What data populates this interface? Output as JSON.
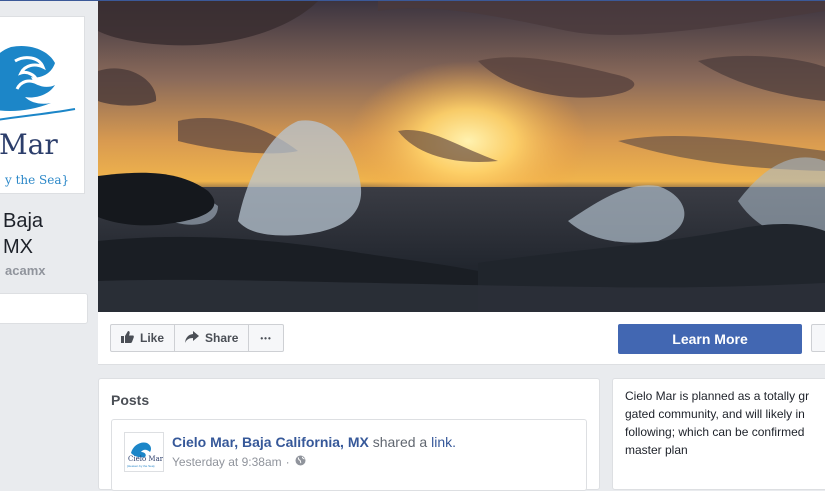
{
  "page": {
    "name_line1": "Baja",
    "name_line2": "MX",
    "handle": "acamx",
    "logo_text": "Mar",
    "logo_tagline": "y the Sea}"
  },
  "actions": {
    "like_label": "Like",
    "share_label": "Share",
    "more_label": "•••",
    "learn_more_label": "Learn More"
  },
  "posts": {
    "title": "Posts",
    "post": {
      "author": "Cielo Mar, Baja California, MX",
      "action_prefix": "shared a",
      "action_link": "link.",
      "timestamp": "Yesterday at 9:38am",
      "separator": "·",
      "avatar_text": "Cielo Mar",
      "avatar_tagline": "{Heaven by the Sea}"
    }
  },
  "about": {
    "line1": "Cielo Mar is planned as a totally gr",
    "line2": "gated community, and will likely in",
    "line3": "following; which can be confirmed",
    "line4": "master plan"
  },
  "colors": {
    "brand_blue": "#4267b2",
    "link_blue": "#365899",
    "background": "#e9ebee"
  },
  "icons": [
    "thumbs-up-icon",
    "share-arrow-icon",
    "more-dots-icon",
    "globe-icon",
    "wave-logo-icon"
  ]
}
